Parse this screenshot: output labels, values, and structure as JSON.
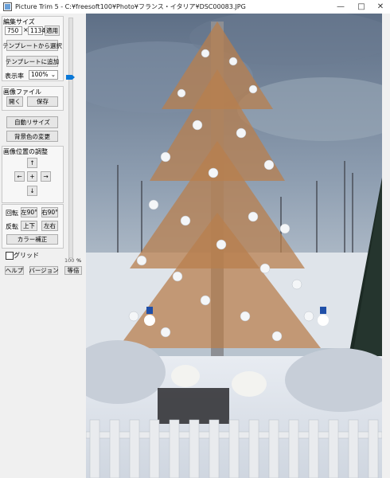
{
  "window": {
    "title": "Picture Trim 5 - C:¥freesoft100¥Photo¥フランス・イタリア¥DSC00083.JPG"
  },
  "edit_size": {
    "heading": "編集サイズ",
    "width": "750",
    "times": "×",
    "height": "1134",
    "apply": "適用",
    "select_template": "テンプレートから選択",
    "add_template": "テンプレートに追加",
    "zoom_label": "表示率",
    "zoom_value": "100%"
  },
  "image_file": {
    "heading": "画像ファイル",
    "open": "開く",
    "save": "保存"
  },
  "actions": {
    "auto_resize": "自動リサイズ",
    "bg_color": "背景色の変更"
  },
  "position": {
    "heading": "画像位置の調整",
    "up": "↑",
    "left": "←",
    "center": "+",
    "right": "→",
    "down": "↓"
  },
  "rotate": {
    "label": "回転",
    "left90": "左90°",
    "right90": "右90°"
  },
  "flip": {
    "label": "反転",
    "vertical": "上下",
    "horizontal": "左右"
  },
  "color_correct": "カラー補正",
  "grid": {
    "label": "グリッド"
  },
  "bottom": {
    "help": "ヘルプ",
    "version": "バージョン",
    "same_size": "等倍"
  },
  "slider": {
    "value": "100",
    "unit": "%"
  },
  "colors": {
    "accent": "#0a78d7"
  }
}
